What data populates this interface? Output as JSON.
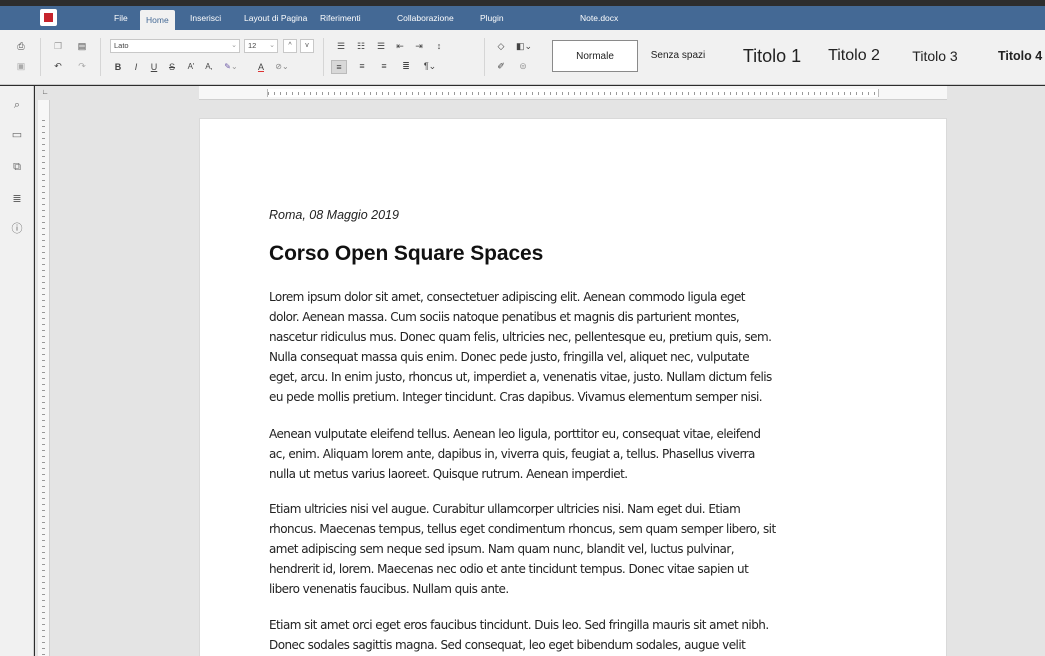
{
  "window": {
    "document_title": "Note.docx"
  },
  "menu": {
    "tabs": [
      "File",
      "Home",
      "Inserisci",
      "Layout di Pagina",
      "Riferimenti",
      "Collaborazione",
      "Plugin"
    ],
    "active_tab": "Home"
  },
  "toolbar": {
    "font_name": "Lato",
    "font_size": "12",
    "bold_label": "B",
    "italic_label": "I",
    "underline_label": "U",
    "strike_label": "S",
    "superscript_label": "A'",
    "subscript_label": "A,",
    "font_color_label": "A",
    "styles": [
      "Normale",
      "Senza spazi",
      "Titolo 1",
      "Titolo 2",
      "Titolo 3",
      "Titolo 4"
    ],
    "active_style": "Normale"
  },
  "colors": {
    "title_bar": "#446995",
    "accent_red": "#c6242d",
    "toolbar_bg": "#f1f1f1"
  },
  "document": {
    "date": "Roma, 08 Maggio 2019",
    "heading": "Corso Open Square Spaces",
    "paragraphs": [
      {
        "lines": [
          "Lorem ipsum dolor sit amet, consectetuer adipiscing elit. Aenean commodo ligula eget",
          "dolor. Aenean massa. Cum sociis natoque penatibus et magnis dis parturient montes,",
          "nascetur ridiculus mus. Donec quam felis, ultricies nec, pellentesque eu, pretium quis, sem.",
          "Nulla consequat massa quis enim. Donec pede justo, fringilla vel, aliquet nec, vulputate",
          "eget, arcu. In enim justo, rhoncus ut, imperdiet a, venenatis vitae, justo. Nullam dictum felis",
          "eu pede mollis pretium. Integer tincidunt. Cras dapibus. Vivamus elementum semper nisi."
        ]
      },
      {
        "lines": [
          "Aenean vulputate eleifend tellus. Aenean leo ligula, porttitor eu, consequat vitae, eleifend",
          "ac, enim. Aliquam lorem ante, dapibus in, viverra quis, feugiat a, tellus. Phasellus viverra",
          "nulla ut metus varius laoreet. Quisque rutrum. Aenean imperdiet."
        ]
      },
      {
        "lines": [
          "Etiam ultricies nisi vel augue. Curabitur ullamcorper ultricies nisi. Nam eget dui. Etiam",
          "rhoncus. Maecenas tempus, tellus eget condimentum rhoncus, sem quam semper libero, sit",
          "amet adipiscing sem neque sed ipsum. Nam quam nunc, blandit vel, luctus pulvinar,",
          "hendrerit id, lorem. Maecenas nec odio et ante tincidunt tempus. Donec vitae sapien ut",
          "libero venenatis faucibus. Nullam quis ante."
        ]
      },
      {
        "lines": [
          "Etiam sit amet orci eget eros faucibus tincidunt. Duis leo. Sed fringilla mauris sit amet nibh.",
          "Donec sodales sagittis magna. Sed consequat, leo eget bibendum sodales, augue velit"
        ]
      }
    ]
  }
}
